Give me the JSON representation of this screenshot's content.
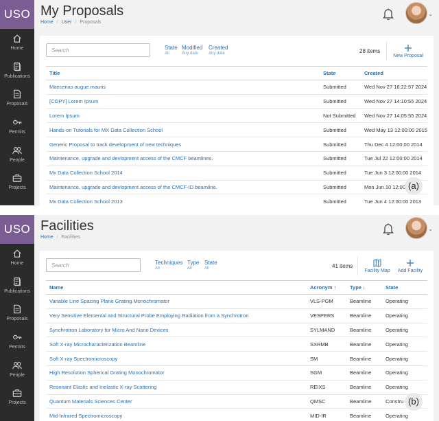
{
  "app": {
    "logo": "USO"
  },
  "nav": {
    "items": [
      {
        "label": "Home",
        "icon": "home-icon"
      },
      {
        "label": "Publications",
        "icon": "publications-icon"
      },
      {
        "label": "Proposals",
        "icon": "proposals-icon"
      },
      {
        "label": "Permits",
        "icon": "permits-icon"
      },
      {
        "label": "People",
        "icon": "people-icon"
      },
      {
        "label": "Projects",
        "icon": "projects-icon"
      }
    ]
  },
  "proposals": {
    "title": "My Proposals",
    "breadcrumb": [
      "Home",
      "User",
      "Proposals"
    ],
    "search_placeholder": "Search",
    "filters": [
      {
        "label": "State",
        "value": "All"
      },
      {
        "label": "Modified",
        "value": "Any date"
      },
      {
        "label": "Created",
        "value": "Any date"
      }
    ],
    "count": "28 items",
    "new_label": "New Proposal",
    "columns": [
      "Title",
      "State",
      "Created"
    ],
    "rows": [
      {
        "title": "Maecenas augue mauris",
        "state": "Submitted",
        "created": "Wed Nov 27 16:22:57 2024"
      },
      {
        "title": "[COPY] Lorem Ipsum",
        "state": "Submitted",
        "created": "Wed Nov 27 14:10:55 2024"
      },
      {
        "title": "Lorem Ipsum",
        "state": "Not Submitted",
        "created": "Wed Nov 27 14:05:55 2024"
      },
      {
        "title": "Hands-on Tutorials for MX Data Collection School",
        "state": "Submitted",
        "created": "Wed May 13 12:00:00 2015"
      },
      {
        "title": "Generic Proposal to track development of new techniques",
        "state": "Submitted",
        "created": "Thu Dec 4 12:00:00 2014"
      },
      {
        "title": "Maintenance, upgrade and devlopment access of the CMCF beamlines.",
        "state": "Submitted",
        "created": "Tue Jul 22 12:00:00 2014"
      },
      {
        "title": "Mx Data Collection School 2014",
        "state": "Submitted",
        "created": "Tue Jun 3 12:00:00 2014"
      },
      {
        "title": "Maintenance, upgrade and devlopment access of the CMCF-ID beamline.",
        "state": "Submitted",
        "created": "Mon Jun 10 12:00:00"
      },
      {
        "title": "Mx Data Collection School 2013",
        "state": "Submitted",
        "created": "Tue Jun 4 12:00:00 2013"
      }
    ],
    "badge": "(a)"
  },
  "facilities": {
    "title": "Facilities",
    "breadcrumb": [
      "Home",
      "Facilities"
    ],
    "search_placeholder": "Search",
    "filters": [
      {
        "label": "Techniques",
        "value": "All"
      },
      {
        "label": "Type",
        "value": "All"
      },
      {
        "label": "State",
        "value": "All"
      }
    ],
    "count": "41 items",
    "map_label": "Facility Map",
    "add_label": "Add Facility",
    "columns": [
      "Name",
      "Acronym ↑",
      "Type ↓",
      "State"
    ],
    "rows": [
      {
        "name": "Variable Line Spacing Plane Grating Monochromator",
        "acronym": "VLS-PGM",
        "type": "Beamline",
        "state": "Operating"
      },
      {
        "name": "Very Sensitive Elemental and Structural Probe Employing Radiation from a Synchrotron",
        "acronym": "VESPERS",
        "type": "Beamline",
        "state": "Operating"
      },
      {
        "name": "Synchrotron Laboratory for Micro And Nano Devices",
        "acronym": "SYLMAND",
        "type": "Beamline",
        "state": "Operating"
      },
      {
        "name": "Soft X-ray Microcharacterization Beamline",
        "acronym": "SXRMB",
        "type": "Beamline",
        "state": "Operating"
      },
      {
        "name": "Soft X-ray Spectromicroscopy",
        "acronym": "SM",
        "type": "Beamline",
        "state": "Operating"
      },
      {
        "name": "High Resolution Spherical Grating Monochromator",
        "acronym": "SGM",
        "type": "Beamline",
        "state": "Operating"
      },
      {
        "name": "Resonant Elastic and Inelastic X-ray Scattering",
        "acronym": "REIXS",
        "type": "Beamline",
        "state": "Operating"
      },
      {
        "name": "Quantum Materials Sciences Center",
        "acronym": "QMSC",
        "type": "Beamline",
        "state": "Constru"
      },
      {
        "name": "Mid-Infrared Spectromicroscopy",
        "acronym": "MID-IR",
        "type": "Beamline",
        "state": "Operating"
      }
    ],
    "badge": "(b)"
  },
  "colors": {
    "accent": "#2a6fb0",
    "logo_bg": "#7b5c93",
    "sidebar_bg": "#2b2b2b"
  }
}
